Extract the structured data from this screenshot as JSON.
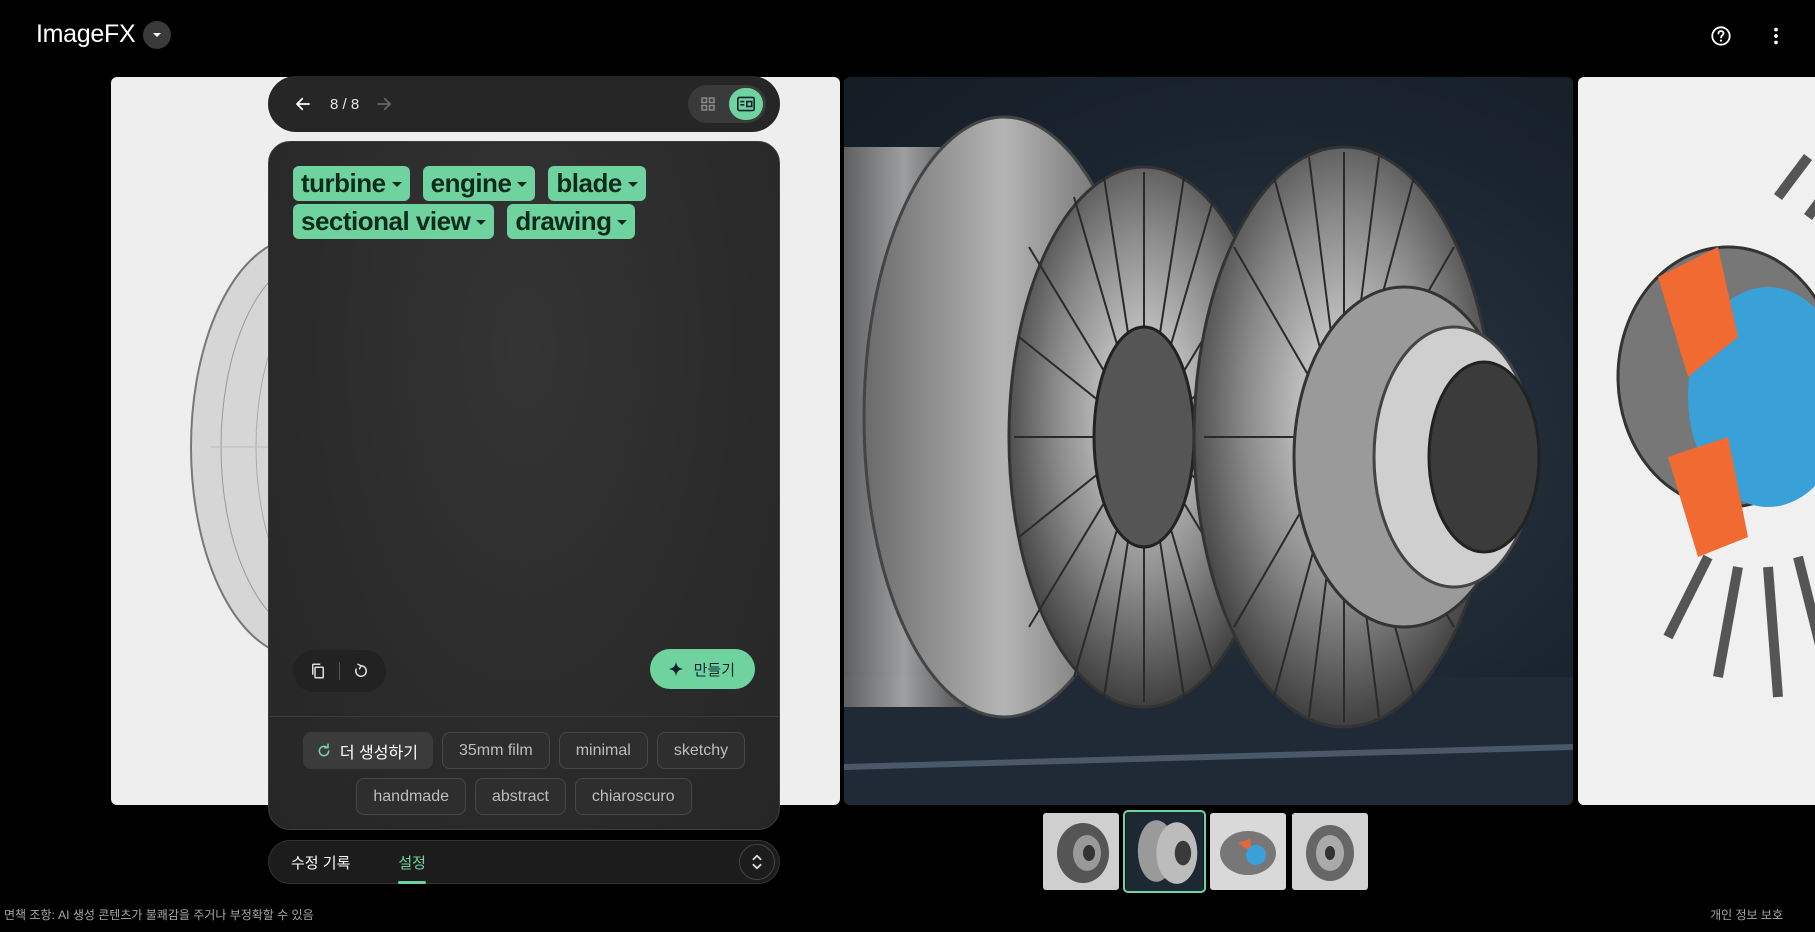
{
  "app": {
    "title": "ImageFX"
  },
  "nav": {
    "page_indicator": "8 / 8"
  },
  "prompt": {
    "chips": [
      {
        "label": "turbine"
      },
      {
        "label": "engine"
      },
      {
        "label": "blade"
      },
      {
        "label": "sectional view"
      },
      {
        "label": "drawing"
      }
    ],
    "create_label": "만들기"
  },
  "suggestions": {
    "regenerate_label": "더 생성하기",
    "items": [
      "35mm film",
      "minimal",
      "sketchy",
      "handmade",
      "abstract",
      "chiaroscuro"
    ]
  },
  "tabs": [
    {
      "label": "수정 기록",
      "active": false
    },
    {
      "label": "설정",
      "active": true
    }
  ],
  "thumbnails": {
    "count": 4,
    "selected_index": 1
  },
  "footer": {
    "disclaimer": "면책 조항: AI 생성 콘텐츠가 불쾌감을 주거나 부정확할 수 있음",
    "privacy": "개인 정보 보호"
  },
  "colors": {
    "accent": "#6fd3a0",
    "background": "#000000",
    "panel": "#2b2b2b"
  },
  "icons": [
    "chevron-down-icon",
    "help-icon",
    "more-vert-icon",
    "arrow-back-icon",
    "arrow-forward-icon",
    "grid-view-icon",
    "detail-view-icon",
    "copy-icon",
    "refresh-icon",
    "sparkle-icon",
    "expand-icon"
  ]
}
